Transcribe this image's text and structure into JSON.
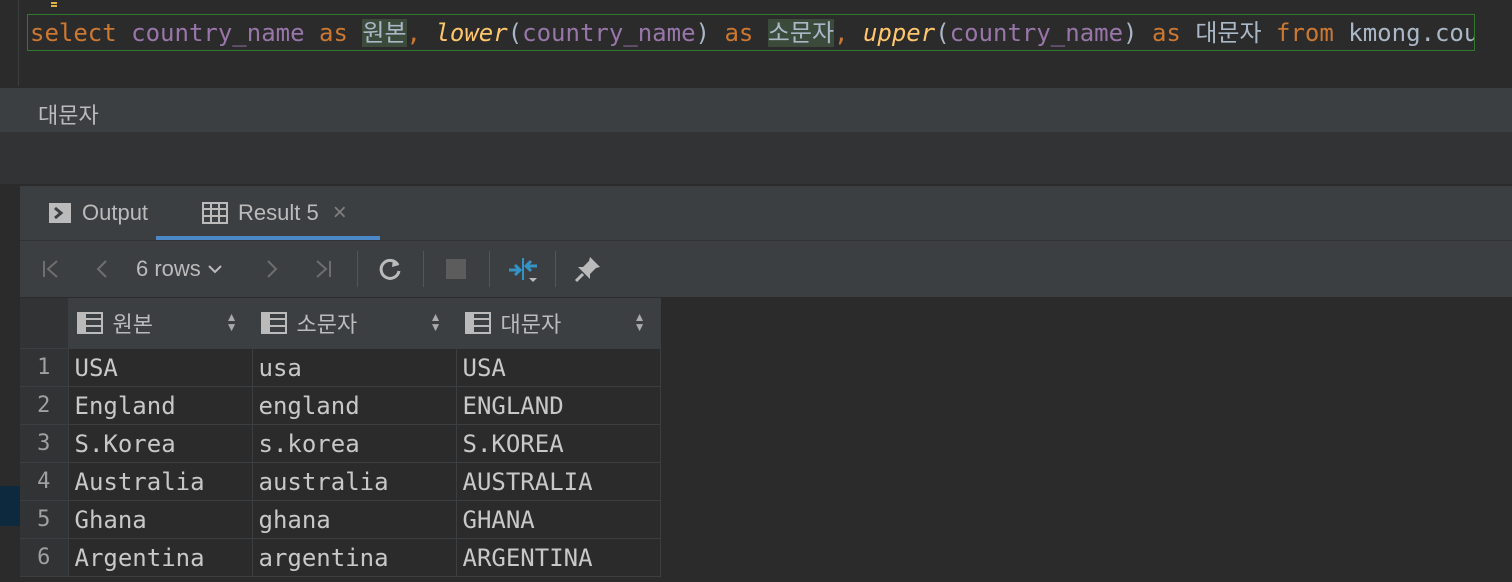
{
  "editor": {
    "query_tokens": [
      {
        "t": "select",
        "c": "kw"
      },
      {
        "t": " ",
        "c": "pl"
      },
      {
        "t": "country_name",
        "c": "col"
      },
      {
        "t": " ",
        "c": "pl"
      },
      {
        "t": "as",
        "c": "kw"
      },
      {
        "t": " ",
        "c": "pl"
      },
      {
        "t": "원본",
        "c": "alias"
      },
      {
        "t": ", ",
        "c": "kw"
      },
      {
        "t": "lower",
        "c": "fn"
      },
      {
        "t": "(",
        "c": "pl"
      },
      {
        "t": "country_name",
        "c": "col"
      },
      {
        "t": ")",
        "c": "pl"
      },
      {
        "t": " ",
        "c": "pl"
      },
      {
        "t": "as",
        "c": "kw"
      },
      {
        "t": " ",
        "c": "pl"
      },
      {
        "t": "소문자",
        "c": "alias"
      },
      {
        "t": ", ",
        "c": "kw"
      },
      {
        "t": "upper",
        "c": "fn"
      },
      {
        "t": "(",
        "c": "pl"
      },
      {
        "t": "country_name",
        "c": "col"
      },
      {
        "t": ")",
        "c": "pl"
      },
      {
        "t": " ",
        "c": "pl"
      },
      {
        "t": "as",
        "c": "kw"
      },
      {
        "t": " ",
        "c": "pl"
      },
      {
        "t": "대문자",
        "c": "pl"
      },
      {
        "t": " ",
        "c": "pl"
      },
      {
        "t": "from",
        "c": "kw"
      },
      {
        "t": " ",
        "c": "pl"
      },
      {
        "t": "kmong.country",
        "c": "pl"
      }
    ],
    "query_end": ";",
    "colors": {
      "keyword": "#cc7832",
      "column": "#9876aa",
      "function": "#ffc66d",
      "plain": "#a9b7c6",
      "border": "#2f7a2f"
    }
  },
  "hint": {
    "text": "대문자"
  },
  "tabs": {
    "output_label": "Output",
    "result_label": "Result 5",
    "close_glyph": "×"
  },
  "toolbar": {
    "rows_label": "6 rows",
    "icons": [
      "first-page-icon",
      "prev-page-icon",
      "rows-dropdown",
      "next-page-icon",
      "last-page-icon",
      "refresh-icon",
      "stop-icon",
      "compare-icon",
      "pin-icon"
    ]
  },
  "grid": {
    "columns": [
      "원본",
      "소문자",
      "대문자"
    ],
    "rows": [
      {
        "n": "1",
        "cells": [
          "USA",
          "usa",
          "USA"
        ]
      },
      {
        "n": "2",
        "cells": [
          "England",
          "england",
          "ENGLAND"
        ]
      },
      {
        "n": "3",
        "cells": [
          "S.Korea",
          "s.korea",
          "S.KOREA"
        ]
      },
      {
        "n": "4",
        "cells": [
          "Australia",
          "australia",
          "AUSTRALIA"
        ]
      },
      {
        "n": "5",
        "cells": [
          "Ghana",
          "ghana",
          "GHANA"
        ]
      },
      {
        "n": "6",
        "cells": [
          "Argentina",
          "argentina",
          "ARGENTINA"
        ]
      }
    ]
  },
  "colors": {
    "accent": "#4a88c7",
    "panel": "#3c3f41",
    "background": "#2b2b2b"
  }
}
